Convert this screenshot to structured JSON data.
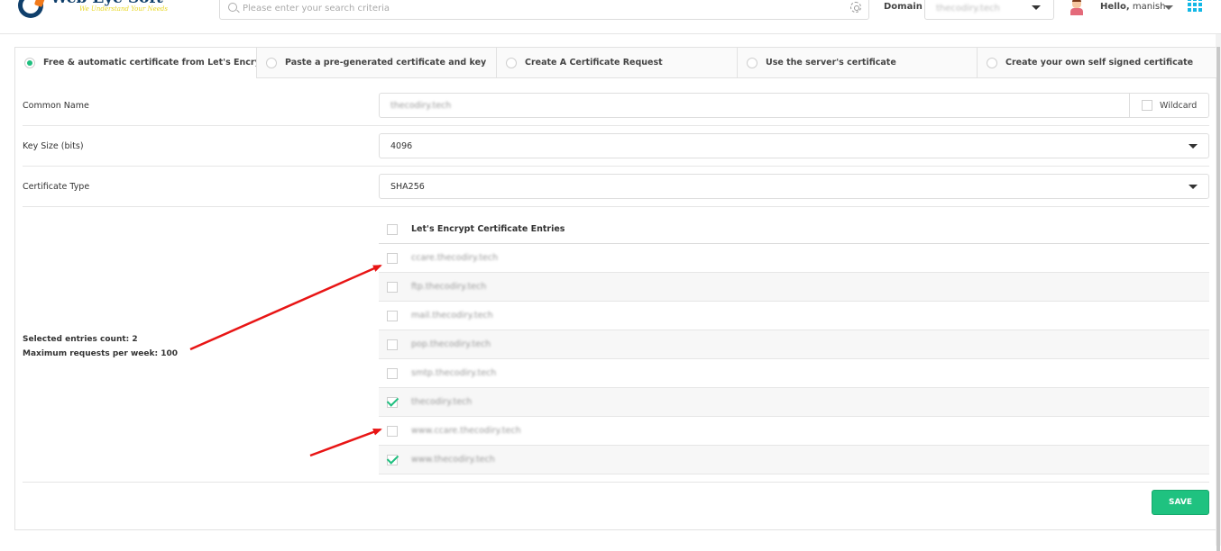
{
  "header": {
    "logo": {
      "title": "Web Eye Soft",
      "tagline": "We Understand Your Needs"
    },
    "search": {
      "placeholder": "Please enter your search criteria",
      "value": ""
    },
    "domain": {
      "label": "Domain",
      "selected": "thecodiry.tech"
    },
    "user": {
      "greeting": "Hello,",
      "name": "manish"
    }
  },
  "tabs": [
    {
      "label": "Free & automatic certificate from Let's Encrypt",
      "selected": true
    },
    {
      "label": "Paste a pre-generated certificate and key",
      "selected": false
    },
    {
      "label": "Create A Certificate Request",
      "selected": false
    },
    {
      "label": "Use the server's certificate",
      "selected": false
    },
    {
      "label": "Create your own self signed certificate",
      "selected": false
    }
  ],
  "form": {
    "common_name": {
      "label": "Common Name",
      "value": "thecodiry.tech",
      "wildcard_label": "Wildcard",
      "wildcard_checked": false
    },
    "key_size": {
      "label": "Key Size (bits)",
      "value": "4096"
    },
    "certificate_type": {
      "label": "Certificate Type",
      "value": "SHA256"
    }
  },
  "entries": {
    "header": "Let's Encrypt Certificate Entries",
    "items": [
      {
        "name": "ccare.thecodiry.tech",
        "checked": false
      },
      {
        "name": "ftp.thecodiry.tech",
        "checked": false
      },
      {
        "name": "mail.thecodiry.tech",
        "checked": false
      },
      {
        "name": "pop.thecodiry.tech",
        "checked": false
      },
      {
        "name": "smtp.thecodiry.tech",
        "checked": false
      },
      {
        "name": "thecodiry.tech",
        "checked": true
      },
      {
        "name": "www.ccare.thecodiry.tech",
        "checked": false
      },
      {
        "name": "www.thecodiry.tech",
        "checked": true
      }
    ]
  },
  "summary": {
    "selected_count": "Selected entries count: 2",
    "max_requests": "Maximum requests per week: 100"
  },
  "actions": {
    "save_label": "SAVE"
  },
  "colors": {
    "accent": "#1fc280",
    "annotation": "#e81515",
    "apps_icon": "#13b8e6",
    "brand": "#0f3f6b"
  }
}
